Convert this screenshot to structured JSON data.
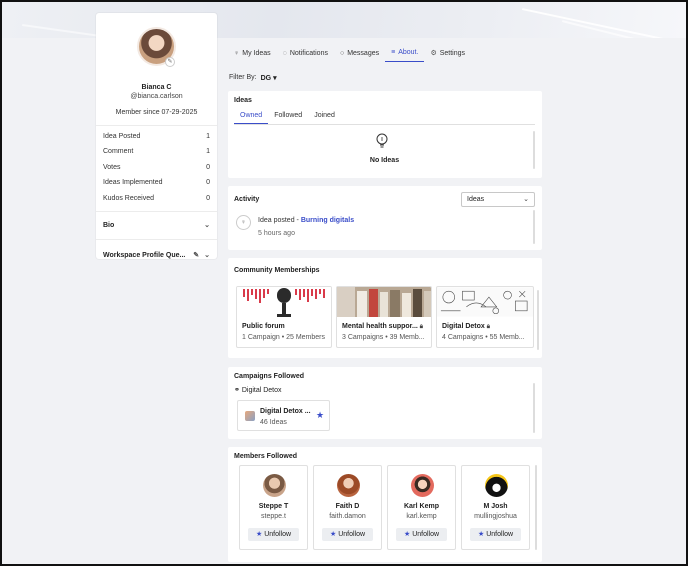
{
  "profile": {
    "name": "Bianca C",
    "handle": "@bianca.carlson",
    "member_since": "Member since 07-29-2025",
    "stats": [
      {
        "label": "Idea Posted",
        "value": "1"
      },
      {
        "label": "Comment",
        "value": "1"
      },
      {
        "label": "Votes",
        "value": "0"
      },
      {
        "label": "Ideas Implemented",
        "value": "0"
      },
      {
        "label": "Kudos Received",
        "value": "0"
      }
    ],
    "bio_label": "Bio",
    "workspace_label": "Workspace Profile Que..."
  },
  "tabs": [
    {
      "label": "My Ideas",
      "icon": "lightbulb-icon"
    },
    {
      "label": "Notifications",
      "icon": "bell-icon"
    },
    {
      "label": "Messages",
      "icon": "chat-icon"
    },
    {
      "label": "About.",
      "icon": "list-icon"
    },
    {
      "label": "Settings",
      "icon": "gear-icon"
    }
  ],
  "active_tab": "About.",
  "filter": {
    "label": "Filter By:",
    "value": "DG"
  },
  "ideas": {
    "title": "Ideas",
    "subtabs": [
      "Owned",
      "Followed",
      "Joined"
    ],
    "active_subtab": "Owned",
    "empty_text": "No Ideas"
  },
  "activity": {
    "title": "Activity",
    "select_value": "Ideas",
    "item_prefix": "Idea posted - ",
    "item_link": "Burning digitals",
    "item_time": "5 hours ago"
  },
  "community": {
    "title": "Community Memberships",
    "items": [
      {
        "title": "Public forum",
        "sub": "1 Campaign • 25 Members",
        "locked": false
      },
      {
        "title": "Mental health suppor...",
        "sub": "3 Campaigns • 39 Memb...",
        "locked": true
      },
      {
        "title": "Digital Detox",
        "sub": "4 Campaigns • 55 Memb...",
        "locked": true
      }
    ]
  },
  "campaigns": {
    "title": "Campaigns Followed",
    "group": "Digital Detox",
    "card_title": "Digital Detox ...",
    "card_sub": "46 Ideas"
  },
  "members": {
    "title": "Members Followed",
    "button_label": "Unfollow",
    "items": [
      {
        "name": "Steppe T",
        "handle": "steppe.t",
        "color": "#c9a48a"
      },
      {
        "name": "Faith D",
        "handle": "faith.damon",
        "color": "#b8643f"
      },
      {
        "name": "Karl Kemp",
        "handle": "karl.kemp",
        "color": "#e36a5e"
      },
      {
        "name": "M Josh",
        "handle": "mullingjoshua",
        "color": "#f5c518"
      }
    ]
  },
  "colors": {
    "accent": "#3a4dc9"
  }
}
